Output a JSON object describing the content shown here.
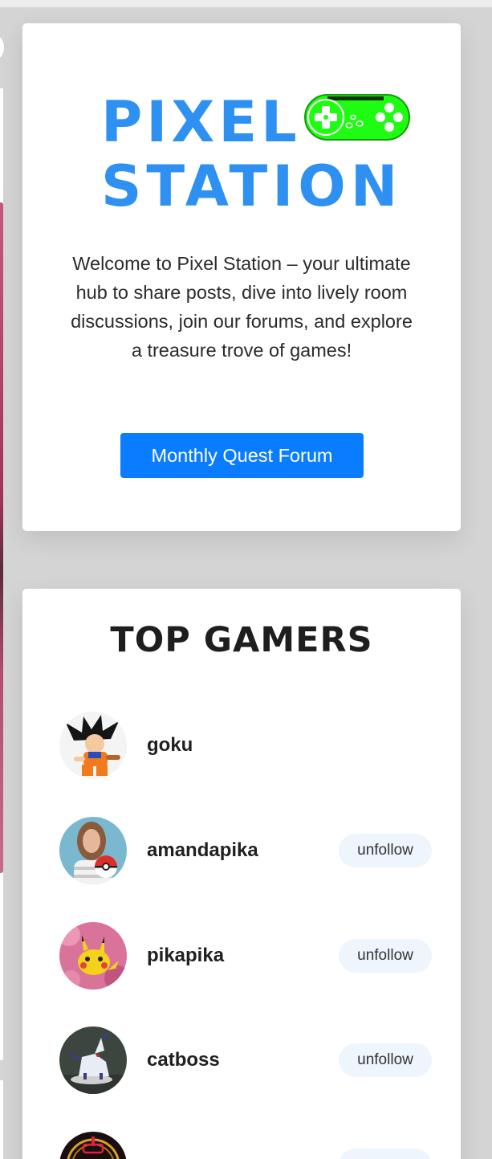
{
  "welcome": {
    "logo_line_1": "PIXEL",
    "logo_line_2": "STATION",
    "description": "Welcome to Pixel Station – your ultimate hub to share posts, dive into lively room discussions, join our forums, and explore a treasure trove of games!",
    "button_label": "Monthly Quest Forum",
    "accent_color": "#2e90f0",
    "button_color": "#0a7cff",
    "controller_color": "#1efc12"
  },
  "top_gamers": {
    "title": "TOP GAMERS",
    "gamers": [
      {
        "name": "goku",
        "action": "",
        "avatar_icon": "goku-avatar"
      },
      {
        "name": "amandapika",
        "action": "unfollow",
        "avatar_icon": "woman-pokeball-avatar"
      },
      {
        "name": "pikapika",
        "action": "unfollow",
        "avatar_icon": "pikachu-avatar"
      },
      {
        "name": "catboss",
        "action": "unfollow",
        "avatar_icon": "absol-figure-avatar"
      },
      {
        "name": "",
        "action": "",
        "avatar_icon": "neon-joystick-avatar"
      }
    ]
  }
}
